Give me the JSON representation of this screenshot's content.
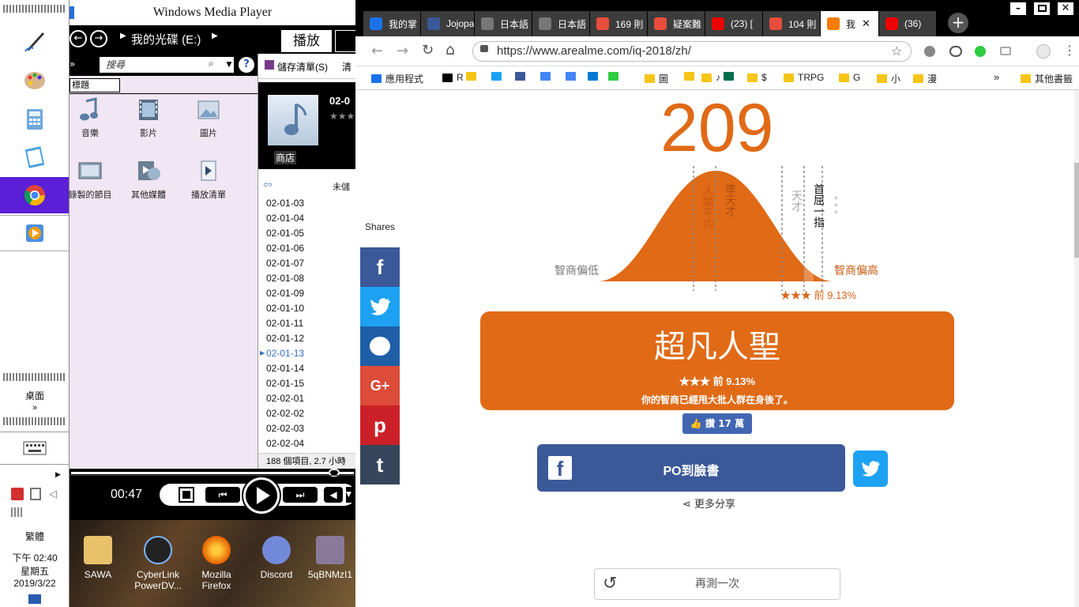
{
  "taskbar": {
    "desktop_label": "桌面",
    "lang": "繁體",
    "time": "下午 02:40",
    "weekday": "星期五",
    "date": "2019/3/22"
  },
  "wmp": {
    "title": "Windows Media Player",
    "breadcrumb": "我的光碟 (E:)",
    "tab_play": "播放",
    "search_placeholder": "搜尋",
    "save_list": "儲存清單(S)",
    "clear_list": "清",
    "subtitle": "標題",
    "library": [
      "音樂",
      "影片",
      "圖片",
      "錄製的節目",
      "其他媒體",
      "播放清單"
    ],
    "store": "商店",
    "album_date": "02-0",
    "unsaved": "未儲",
    "tracks": [
      "02-01-03",
      "02-01-04",
      "02-01-05",
      "02-01-06",
      "02-01-07",
      "02-01-08",
      "02-01-09",
      "02-01-10",
      "02-01-11",
      "02-01-12",
      "02-01-13",
      "02-01-14",
      "02-01-15",
      "02-02-01",
      "02-02-02",
      "02-02-03",
      "02-02-04"
    ],
    "current_track_index": 10,
    "footer": "188 個項目, 2.7 小時",
    "time": "00:47",
    "progress": 0.96
  },
  "desktop_icons": [
    "SAWA",
    "CyberLink PowerDV...",
    "Mozilla Firefox",
    "Discord",
    "5qBNMzI1"
  ],
  "chrome": {
    "tabs": [
      "我的掌",
      "Jojopa",
      "日本語",
      "日本語",
      "169 則",
      "疑案難",
      "(23) [",
      "104 則",
      "我",
      "(36)"
    ],
    "active_tab_index": 8,
    "url": "https://www.arealme.com/iq-2018/zh/",
    "bookmarks": [
      "應用程式",
      "R",
      "",
      "",
      "",
      "",
      "",
      "",
      "",
      "圖",
      "",
      "♪",
      "",
      "$",
      "TRPG",
      "G",
      "小",
      "漫"
    ],
    "other_bookmarks": "其他書籤",
    "more": "»"
  },
  "page": {
    "shares_label": "Shares",
    "score": "209",
    "curve_labels": {
      "low": "智商偏低",
      "high": "智商偏高",
      "avg": "人類平均",
      "near_genius": "準天才",
      "genius": "天才",
      "top": "首屈一指",
      "stars_small": "★★★",
      "percentile": "★★★ 前 9.13%"
    },
    "title": "超凡人聖",
    "rank": "★★★ 前 9.13%",
    "desc": "你的智商已經甩大批人群在身後了。",
    "like": "讚 17 萬",
    "fb_button": "PO到臉書",
    "more_share": "更多分享",
    "retry": "再測一次"
  },
  "colors": {
    "accent": "#e06a16",
    "facebook": "#3b5998",
    "twitter": "#1da1f2"
  }
}
